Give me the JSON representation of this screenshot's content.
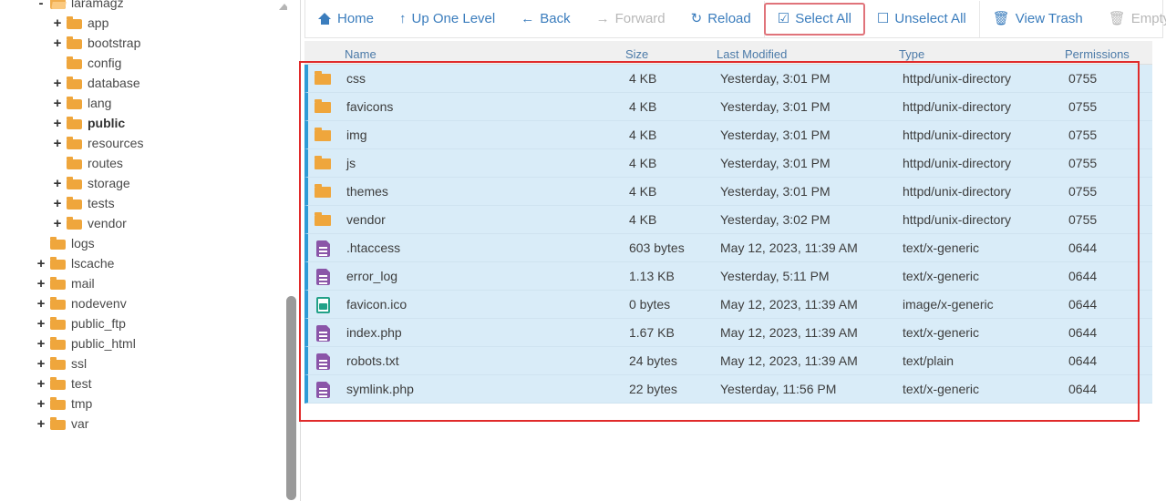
{
  "sidebar": {
    "scroll_arrow_icon": "scroll-up-arrow-icon",
    "tree": [
      {
        "label": "laramagz",
        "indent": 0,
        "toggle": "-",
        "icon": "folder-open-icon",
        "bold": false
      },
      {
        "label": "app",
        "indent": 1,
        "toggle": "+",
        "icon": "folder-icon",
        "bold": false
      },
      {
        "label": "bootstrap",
        "indent": 1,
        "toggle": "+",
        "icon": "folder-icon",
        "bold": false
      },
      {
        "label": "config",
        "indent": 1,
        "toggle": "",
        "icon": "folder-icon",
        "bold": false
      },
      {
        "label": "database",
        "indent": 1,
        "toggle": "+",
        "icon": "folder-icon",
        "bold": false
      },
      {
        "label": "lang",
        "indent": 1,
        "toggle": "+",
        "icon": "folder-icon",
        "bold": false
      },
      {
        "label": "public",
        "indent": 1,
        "toggle": "+",
        "icon": "folder-icon",
        "bold": true
      },
      {
        "label": "resources",
        "indent": 1,
        "toggle": "+",
        "icon": "folder-icon",
        "bold": false
      },
      {
        "label": "routes",
        "indent": 1,
        "toggle": "",
        "icon": "folder-icon",
        "bold": false
      },
      {
        "label": "storage",
        "indent": 1,
        "toggle": "+",
        "icon": "folder-icon",
        "bold": false
      },
      {
        "label": "tests",
        "indent": 1,
        "toggle": "+",
        "icon": "folder-icon",
        "bold": false
      },
      {
        "label": "vendor",
        "indent": 1,
        "toggle": "+",
        "icon": "folder-icon",
        "bold": false
      },
      {
        "label": "logs",
        "indent": 0,
        "toggle": "",
        "icon": "folder-icon",
        "bold": false
      },
      {
        "label": "lscache",
        "indent": 0,
        "toggle": "+",
        "icon": "folder-icon",
        "bold": false
      },
      {
        "label": "mail",
        "indent": 0,
        "toggle": "+",
        "icon": "folder-icon",
        "bold": false
      },
      {
        "label": "nodevenv",
        "indent": 0,
        "toggle": "+",
        "icon": "folder-icon",
        "bold": false
      },
      {
        "label": "public_ftp",
        "indent": 0,
        "toggle": "+",
        "icon": "folder-icon",
        "bold": false
      },
      {
        "label": "public_html",
        "indent": 0,
        "toggle": "+",
        "icon": "folder-icon",
        "bold": false
      },
      {
        "label": "ssl",
        "indent": 0,
        "toggle": "+",
        "icon": "folder-icon",
        "bold": false
      },
      {
        "label": "test",
        "indent": 0,
        "toggle": "+",
        "icon": "folder-icon",
        "bold": false
      },
      {
        "label": "tmp",
        "indent": 0,
        "toggle": "+",
        "icon": "folder-icon",
        "bold": false
      },
      {
        "label": "var",
        "indent": 0,
        "toggle": "+",
        "icon": "folder-icon",
        "bold": false
      }
    ]
  },
  "toolbar": {
    "buttons": [
      {
        "label": "Home",
        "icon": "home-icon",
        "state": "enabled",
        "separator_before": false
      },
      {
        "label": "Up One Level",
        "icon": "arrow-up-icon",
        "state": "enabled",
        "separator_before": false
      },
      {
        "label": "Back",
        "icon": "arrow-left-icon",
        "state": "enabled",
        "separator_before": false
      },
      {
        "label": "Forward",
        "icon": "arrow-right-icon",
        "state": "disabled",
        "separator_before": false
      },
      {
        "label": "Reload",
        "icon": "reload-icon",
        "state": "enabled",
        "separator_before": false
      },
      {
        "label": "Select All",
        "icon": "checkbox-checked-icon",
        "state": "highlighted",
        "separator_before": true
      },
      {
        "label": "Unselect All",
        "icon": "checkbox-empty-icon",
        "state": "enabled",
        "separator_before": false
      },
      {
        "label": "View Trash",
        "icon": "trash-icon",
        "state": "enabled",
        "separator_before": true
      },
      {
        "label": "Empty Trash",
        "icon": "trash-icon",
        "state": "disabled",
        "separator_before": false
      }
    ]
  },
  "table": {
    "columns": [
      "Name",
      "Size",
      "Last Modified",
      "Type",
      "Permissions"
    ],
    "rows": [
      {
        "name": "css",
        "size": "4 KB",
        "modified": "Yesterday, 3:01 PM",
        "type": "httpd/unix-directory",
        "permissions": "0755",
        "icon": "folder-icon",
        "selected": true
      },
      {
        "name": "favicons",
        "size": "4 KB",
        "modified": "Yesterday, 3:01 PM",
        "type": "httpd/unix-directory",
        "permissions": "0755",
        "icon": "folder-icon",
        "selected": true
      },
      {
        "name": "img",
        "size": "4 KB",
        "modified": "Yesterday, 3:01 PM",
        "type": "httpd/unix-directory",
        "permissions": "0755",
        "icon": "folder-icon",
        "selected": true
      },
      {
        "name": "js",
        "size": "4 KB",
        "modified": "Yesterday, 3:01 PM",
        "type": "httpd/unix-directory",
        "permissions": "0755",
        "icon": "folder-icon",
        "selected": true
      },
      {
        "name": "themes",
        "size": "4 KB",
        "modified": "Yesterday, 3:01 PM",
        "type": "httpd/unix-directory",
        "permissions": "0755",
        "icon": "folder-icon",
        "selected": true
      },
      {
        "name": "vendor",
        "size": "4 KB",
        "modified": "Yesterday, 3:02 PM",
        "type": "httpd/unix-directory",
        "permissions": "0755",
        "icon": "folder-icon",
        "selected": true
      },
      {
        "name": ".htaccess",
        "size": "603 bytes",
        "modified": "May 12, 2023, 11:39 AM",
        "type": "text/x-generic",
        "permissions": "0644",
        "icon": "document-icon",
        "selected": true
      },
      {
        "name": "error_log",
        "size": "1.13 KB",
        "modified": "Yesterday, 5:11 PM",
        "type": "text/x-generic",
        "permissions": "0644",
        "icon": "document-icon",
        "selected": true
      },
      {
        "name": "favicon.ico",
        "size": "0 bytes",
        "modified": "May 12, 2023, 11:39 AM",
        "type": "image/x-generic",
        "permissions": "0644",
        "icon": "image-file-icon",
        "selected": true
      },
      {
        "name": "index.php",
        "size": "1.67 KB",
        "modified": "May 12, 2023, 11:39 AM",
        "type": "text/x-generic",
        "permissions": "0644",
        "icon": "document-icon",
        "selected": true
      },
      {
        "name": "robots.txt",
        "size": "24 bytes",
        "modified": "May 12, 2023, 11:39 AM",
        "type": "text/plain",
        "permissions": "0644",
        "icon": "document-icon",
        "selected": true
      },
      {
        "name": "symlink.php",
        "size": "22 bytes",
        "modified": "Yesterday, 11:56 PM",
        "type": "text/x-generic",
        "permissions": "0644",
        "icon": "document-icon",
        "selected": true
      }
    ]
  },
  "annotation": {
    "shape": "rectangle",
    "color": "#e02b2b"
  },
  "colors": {
    "link": "#3b7dbd",
    "row_selected_bg": "#d9ecf8",
    "row_accent": "#2e9bd6",
    "folder": "#efa63c",
    "document": "#8a55a8",
    "image_file": "#23a188",
    "annotation": "#e02b2b"
  }
}
